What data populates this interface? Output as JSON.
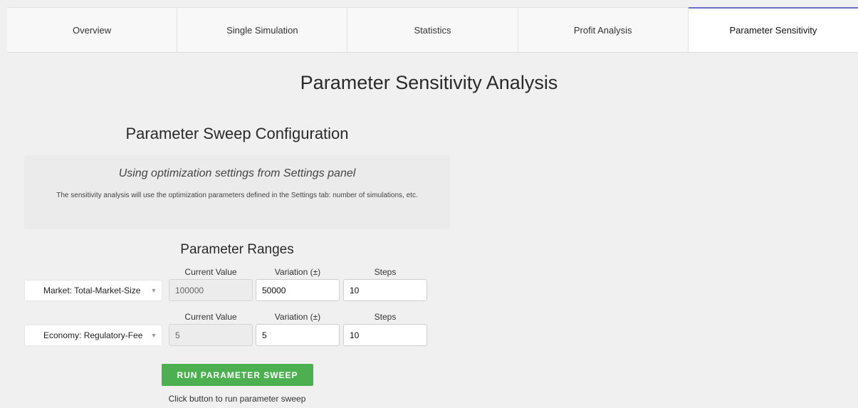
{
  "tabs": [
    {
      "label": "Overview",
      "active": false
    },
    {
      "label": "Single Simulation",
      "active": false
    },
    {
      "label": "Statistics",
      "active": false
    },
    {
      "label": "Profit Analysis",
      "active": false
    },
    {
      "label": "Parameter Sensitivity",
      "active": true
    }
  ],
  "page": {
    "title": "Parameter Sensitivity Analysis"
  },
  "config": {
    "title": "Parameter Sweep Configuration",
    "info_heading": "Using optimization settings from Settings panel",
    "info_text": "The sensitivity analysis will use the optimization parameters defined in the Settings tab: number of simulations, etc."
  },
  "ranges": {
    "title": "Parameter Ranges",
    "col_current": "Current Value",
    "col_variation": "Variation (±)",
    "col_steps": "Steps",
    "rows": [
      {
        "parameter": "Market: Total-Market-Size",
        "current_value": "100000",
        "variation": "50000",
        "steps": "10"
      },
      {
        "parameter": "Economy: Regulatory-Fee",
        "current_value": "5",
        "variation": "5",
        "steps": "10"
      }
    ]
  },
  "actions": {
    "run_label": "RUN PARAMETER SWEEP",
    "status": "Click button to run parameter sweep"
  },
  "colors": {
    "run_button": "#4caf50",
    "active_tab_accent": "#6b72c9"
  },
  "icons": {
    "dropdown": "chevron-down-icon"
  }
}
